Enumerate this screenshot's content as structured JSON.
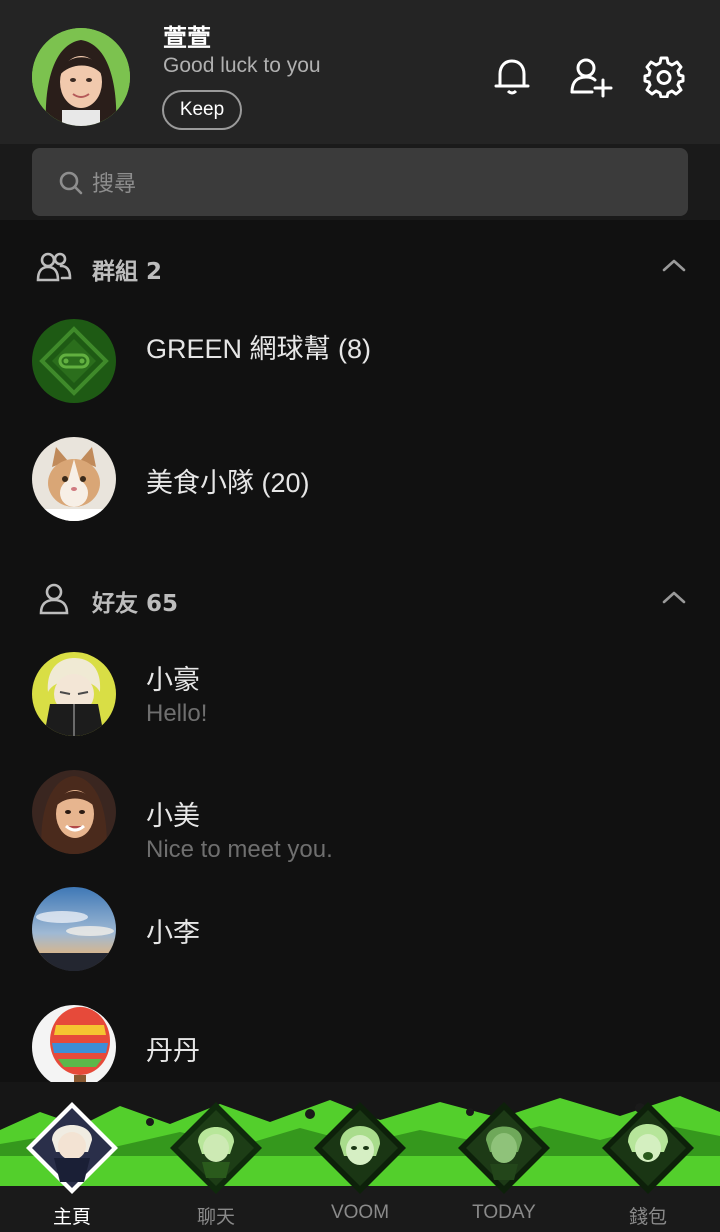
{
  "profile": {
    "name": "萱萱",
    "status": "Good luck to you",
    "keep_label": "Keep"
  },
  "header_icons": [
    "bell-icon",
    "add-friend-icon",
    "gear-icon"
  ],
  "search": {
    "placeholder": "搜尋"
  },
  "groups_section": {
    "title": "群組 2",
    "items": [
      {
        "name": "GREEN 網球幫 (8)"
      },
      {
        "name": "美食小隊 (20)"
      }
    ]
  },
  "friends_section": {
    "title": "好友 65",
    "items": [
      {
        "name": "小豪",
        "message": "Hello!"
      },
      {
        "name": "小美",
        "message": "Nice to meet you."
      },
      {
        "name": "小李",
        "message": ""
      },
      {
        "name": "丹丹",
        "message": ""
      }
    ]
  },
  "tabs": [
    {
      "label": "主頁",
      "active": true
    },
    {
      "label": "聊天",
      "active": false
    },
    {
      "label": "VOOM",
      "active": false
    },
    {
      "label": "TODAY",
      "active": false
    },
    {
      "label": "錢包",
      "active": false
    }
  ],
  "colors": {
    "accent_green": "#4fcf2a",
    "background": "#111111",
    "header": "#242424"
  }
}
